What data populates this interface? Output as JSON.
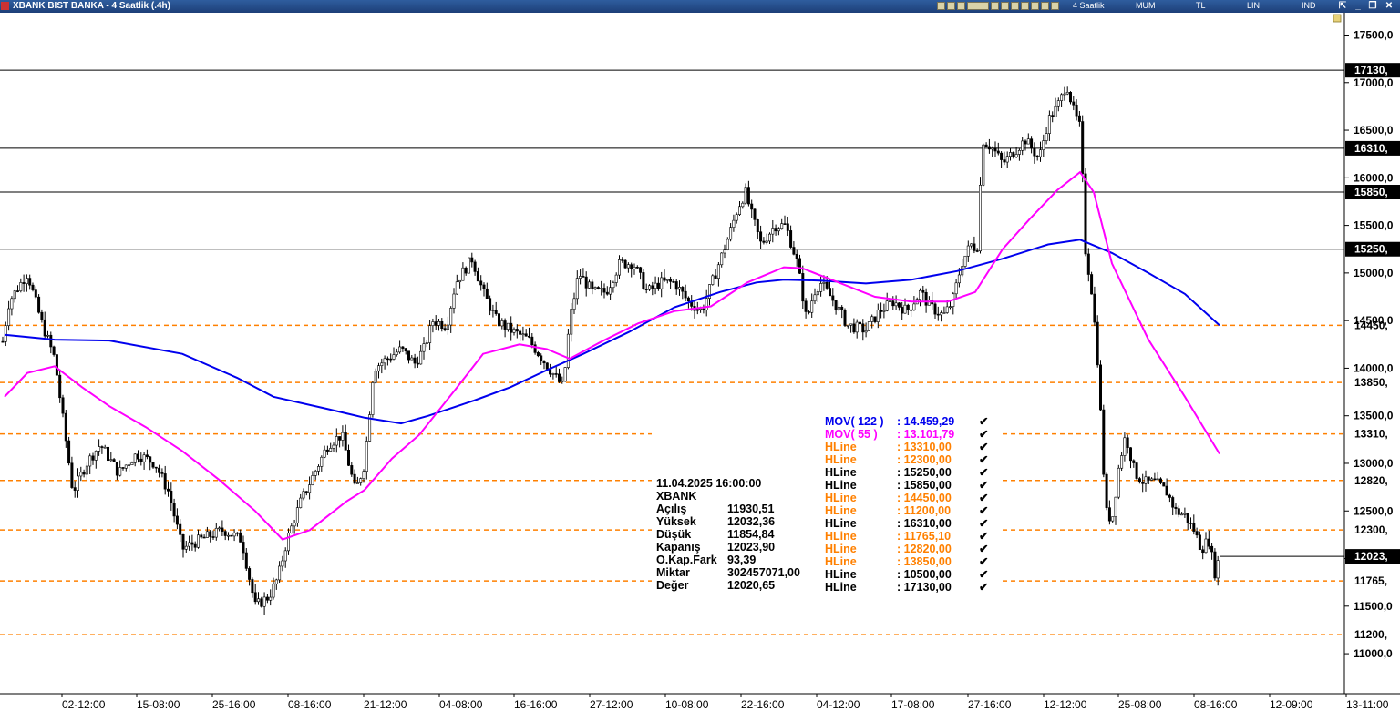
{
  "window": {
    "title": "XBANK BIST BANKA - 4 Saatlik (.4h)",
    "menu": [
      "4 Saatlik",
      "MUM",
      "TL",
      "LIN",
      "IND"
    ]
  },
  "colors": {
    "mov122": "#0000ee",
    "mov55": "#ff00ff",
    "hline_dashed": "#ff8000",
    "hline_solid": "#000000",
    "candle": "#000000"
  },
  "chart_data": {
    "type": "candlestick",
    "symbol": "XBANK",
    "interval": "4 Saatlik",
    "ylim": [
      10750,
      17800
    ],
    "y_ticks": [
      "17500,0",
      "17000,0",
      "16500,0",
      "16000,0",
      "15500,0",
      "15000,0",
      "14500,0",
      "14000,0",
      "13500,0",
      "13000,0",
      "12500,0",
      "12000,0",
      "11500,0",
      "11000,0"
    ],
    "y_tick_values": [
      17500,
      17000,
      16500,
      16000,
      15500,
      15000,
      14500,
      14000,
      13500,
      13000,
      12500,
      12000,
      11500,
      11000
    ],
    "x_ticks": [
      "02-12:00",
      "15-08:00",
      "25-16:00",
      "08-16:00",
      "21-12:00",
      "04-08:00",
      "16-16:00",
      "27-12:00",
      "10-08:00",
      "22-16:00",
      "04-12:00",
      "17-08:00",
      "27-16:00",
      "12-12:00",
      "25-08:00",
      "08-16:00",
      "12-09:00",
      "13-11:00"
    ],
    "price_path": [
      [
        0,
        14100
      ],
      [
        10,
        14700
      ],
      [
        30,
        15000
      ],
      [
        45,
        14500
      ],
      [
        60,
        14100
      ],
      [
        70,
        13400
      ],
      [
        80,
        12700
      ],
      [
        95,
        13000
      ],
      [
        110,
        13200
      ],
      [
        130,
        12900
      ],
      [
        150,
        13100
      ],
      [
        170,
        13000
      ],
      [
        185,
        12700
      ],
      [
        200,
        12100
      ],
      [
        220,
        12200
      ],
      [
        245,
        12300
      ],
      [
        265,
        12200
      ],
      [
        280,
        11500
      ],
      [
        295,
        11600
      ],
      [
        305,
        11800
      ],
      [
        315,
        12200
      ],
      [
        330,
        12600
      ],
      [
        345,
        12900
      ],
      [
        360,
        13200
      ],
      [
        375,
        13300
      ],
      [
        390,
        12700
      ],
      [
        400,
        13000
      ],
      [
        410,
        14000
      ],
      [
        425,
        14100
      ],
      [
        440,
        14200
      ],
      [
        455,
        14050
      ],
      [
        465,
        14200
      ],
      [
        475,
        14500
      ],
      [
        490,
        14450
      ],
      [
        500,
        14900
      ],
      [
        518,
        15150
      ],
      [
        530,
        14800
      ],
      [
        545,
        14500
      ],
      [
        560,
        14400
      ],
      [
        580,
        14300
      ],
      [
        595,
        14100
      ],
      [
        610,
        13900
      ],
      [
        618,
        13800
      ],
      [
        625,
        14500
      ],
      [
        635,
        15000
      ],
      [
        650,
        14800
      ],
      [
        665,
        14800
      ],
      [
        680,
        15100
      ],
      [
        695,
        15100
      ],
      [
        710,
        14800
      ],
      [
        725,
        14900
      ],
      [
        740,
        14900
      ],
      [
        755,
        14700
      ],
      [
        770,
        14600
      ],
      [
        785,
        15000
      ],
      [
        800,
        15400
      ],
      [
        810,
        15700
      ],
      [
        818,
        15850
      ],
      [
        825,
        15600
      ],
      [
        835,
        15300
      ],
      [
        850,
        15500
      ],
      [
        862,
        15500
      ],
      [
        875,
        15100
      ],
      [
        885,
        14500
      ],
      [
        893,
        14800
      ],
      [
        900,
        14900
      ],
      [
        915,
        14700
      ],
      [
        930,
        14450
      ],
      [
        950,
        14400
      ],
      [
        965,
        14600
      ],
      [
        980,
        14700
      ],
      [
        995,
        14600
      ],
      [
        1010,
        14800
      ],
      [
        1020,
        14650
      ],
      [
        1035,
        14550
      ],
      [
        1045,
        14700
      ],
      [
        1055,
        15100
      ],
      [
        1065,
        15300
      ],
      [
        1072,
        15250
      ],
      [
        1078,
        16400
      ],
      [
        1090,
        16300
      ],
      [
        1100,
        16150
      ],
      [
        1115,
        16300
      ],
      [
        1125,
        16400
      ],
      [
        1140,
        16200
      ],
      [
        1150,
        16600
      ],
      [
        1163,
        16800
      ],
      [
        1170,
        17000
      ],
      [
        1178,
        16700
      ],
      [
        1186,
        16500
      ],
      [
        1190,
        15300
      ],
      [
        1198,
        14800
      ],
      [
        1205,
        14000
      ],
      [
        1213,
        12500
      ],
      [
        1220,
        12400
      ],
      [
        1228,
        13000
      ],
      [
        1235,
        13300
      ],
      [
        1245,
        12900
      ],
      [
        1255,
        12800
      ],
      [
        1268,
        12800
      ],
      [
        1280,
        12700
      ],
      [
        1290,
        12500
      ],
      [
        1300,
        12450
      ],
      [
        1310,
        12300
      ],
      [
        1318,
        12100
      ],
      [
        1326,
        12200
      ],
      [
        1333,
        11850
      ],
      [
        1338,
        12023
      ]
    ],
    "mov122_path": [
      [
        5,
        14350
      ],
      [
        60,
        14300
      ],
      [
        120,
        14290
      ],
      [
        200,
        14150
      ],
      [
        260,
        13900
      ],
      [
        300,
        13700
      ],
      [
        360,
        13570
      ],
      [
        400,
        13480
      ],
      [
        440,
        13420
      ],
      [
        470,
        13500
      ],
      [
        520,
        13660
      ],
      [
        560,
        13800
      ],
      [
        600,
        13980
      ],
      [
        640,
        14150
      ],
      [
        690,
        14380
      ],
      [
        740,
        14640
      ],
      [
        790,
        14800
      ],
      [
        830,
        14900
      ],
      [
        860,
        14930
      ],
      [
        900,
        14920
      ],
      [
        950,
        14890
      ],
      [
        1000,
        14930
      ],
      [
        1050,
        15020
      ],
      [
        1100,
        15150
      ],
      [
        1150,
        15300
      ],
      [
        1185,
        15350
      ],
      [
        1220,
        15210
      ],
      [
        1260,
        15000
      ],
      [
        1300,
        14780
      ],
      [
        1338,
        14450
      ]
    ],
    "mov55_path": [
      [
        5,
        13700
      ],
      [
        30,
        13950
      ],
      [
        60,
        14020
      ],
      [
        90,
        13800
      ],
      [
        120,
        13600
      ],
      [
        160,
        13380
      ],
      [
        200,
        13130
      ],
      [
        240,
        12830
      ],
      [
        280,
        12500
      ],
      [
        310,
        12200
      ],
      [
        340,
        12300
      ],
      [
        380,
        12600
      ],
      [
        400,
        12720
      ],
      [
        430,
        13050
      ],
      [
        460,
        13300
      ],
      [
        500,
        13780
      ],
      [
        530,
        14150
      ],
      [
        570,
        14250
      ],
      [
        600,
        14200
      ],
      [
        625,
        14100
      ],
      [
        660,
        14280
      ],
      [
        700,
        14470
      ],
      [
        740,
        14600
      ],
      [
        780,
        14650
      ],
      [
        820,
        14900
      ],
      [
        860,
        15060
      ],
      [
        880,
        15050
      ],
      [
        920,
        14900
      ],
      [
        960,
        14750
      ],
      [
        1000,
        14700
      ],
      [
        1040,
        14700
      ],
      [
        1070,
        14800
      ],
      [
        1100,
        15250
      ],
      [
        1130,
        15570
      ],
      [
        1160,
        15870
      ],
      [
        1185,
        16060
      ],
      [
        1200,
        15850
      ],
      [
        1220,
        15100
      ],
      [
        1260,
        14300
      ],
      [
        1300,
        13700
      ],
      [
        1338,
        13100
      ]
    ],
    "h_levels": [
      {
        "label": "17130,",
        "value": 17130,
        "style": "solid"
      },
      {
        "label": "16310,",
        "value": 16310,
        "style": "solid"
      },
      {
        "label": "15850,",
        "value": 15850,
        "style": "solid"
      },
      {
        "label": "15250,",
        "value": 15250,
        "style": "solid"
      },
      {
        "label": "14450,",
        "value": 14450,
        "style": "dashed"
      },
      {
        "label": "13850,",
        "value": 13850,
        "style": "dashed"
      },
      {
        "label": "13310,",
        "value": 13310,
        "style": "dashed"
      },
      {
        "label": "12820,",
        "value": 12820,
        "style": "dashed"
      },
      {
        "label": "12300,",
        "value": 12300,
        "style": "dashed"
      },
      {
        "label": "12023,",
        "value": 12023,
        "style": "current"
      },
      {
        "label": "11765,",
        "value": 11765,
        "style": "dashed"
      },
      {
        "label": "11200,",
        "value": 11200,
        "style": "dashed"
      }
    ],
    "info_box": {
      "datetime": "11.04.2025  16:00:00",
      "symbol": "XBANK",
      "rows": [
        {
          "label": "Açılış",
          "value": "11930,51"
        },
        {
          "label": "Yüksek",
          "value": "12032,36"
        },
        {
          "label": "Düşük",
          "value": "11854,84"
        },
        {
          "label": "Kapanış",
          "value": "12023,90"
        },
        {
          "label": "O.Kap.Fark",
          "value": "93,39"
        },
        {
          "label": "Miktar",
          "value": "302457071,00"
        },
        {
          "label": "Değer",
          "value": "12020,65"
        }
      ]
    },
    "legend": [
      {
        "name": "MOV( 122 )",
        "value": ": 14.459,29",
        "color": "#0000ee"
      },
      {
        "name": "MOV( 55 )",
        "value": ": 13.101,79",
        "color": "#ff00ff"
      },
      {
        "name": "HLine",
        "value": ": 13310,00",
        "color": "#ff8000"
      },
      {
        "name": "HLine",
        "value": ": 12300,00",
        "color": "#ff8000"
      },
      {
        "name": "HLine",
        "value": ": 15250,00",
        "color": "#000000"
      },
      {
        "name": "HLine",
        "value": ": 15850,00",
        "color": "#000000"
      },
      {
        "name": "HLine",
        "value": ": 14450,00",
        "color": "#ff8000"
      },
      {
        "name": "HLine",
        "value": ": 11200,00",
        "color": "#ff8000"
      },
      {
        "name": "HLine",
        "value": ": 16310,00",
        "color": "#000000"
      },
      {
        "name": "HLine",
        "value": ": 11765,10",
        "color": "#ff8000"
      },
      {
        "name": "HLine",
        "value": ": 12820,00",
        "color": "#ff8000"
      },
      {
        "name": "HLine",
        "value": ": 13850,00",
        "color": "#ff8000"
      },
      {
        "name": "HLine",
        "value": ": 10500,00",
        "color": "#000000"
      },
      {
        "name": "HLine",
        "value": ": 17130,00",
        "color": "#000000"
      }
    ]
  }
}
